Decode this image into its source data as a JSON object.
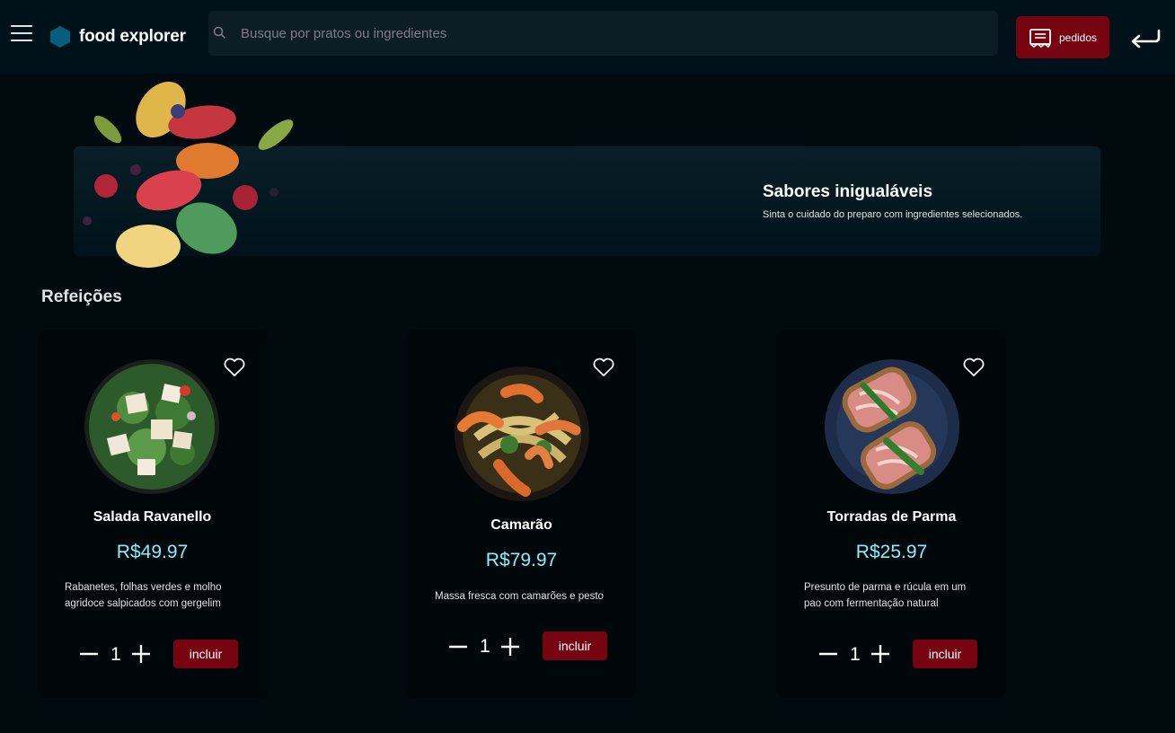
{
  "header": {
    "app_name": "food explorer",
    "search": {
      "placeholder": "Busque por pratos ou ingredientes",
      "value": ""
    },
    "orders_label": "pedidos",
    "icons": {
      "menu": "hamburger-menu-icon",
      "logo": "hexagon-logo-icon",
      "search": "search-icon",
      "orders": "receipt-icon",
      "logout": "return-arrow-icon"
    }
  },
  "banner": {
    "title": "Sabores inigualáveis",
    "subtitle": "Sinta o cuidado do preparo com ingredientes selecionados."
  },
  "section": {
    "title": "Refeições"
  },
  "dishes": [
    {
      "name": "Salada Ravanello",
      "price": "R$49.97",
      "description": "Rabanetes, folhas verdes e molho agridoce salpicados com gergelim",
      "quantity": "1",
      "button_label": "incluir",
      "favorited": false
    },
    {
      "name": "Camarão",
      "price": "R$79.97",
      "description": "Massa fresca com camarões e pesto",
      "quantity": "1",
      "button_label": "incluir",
      "favorited": false
    },
    {
      "name": "Torradas de Parma",
      "price": "R$25.97",
      "description": "Presunto de parma e rúcula em um pao com fermentação natural",
      "quantity": "1",
      "button_label": "incluir",
      "favorited": false
    }
  ],
  "colors": {
    "background": "#000a0f",
    "header": "#00111a",
    "accent_red": "#750310",
    "price": "#82f3ff",
    "card": "#00070a"
  }
}
